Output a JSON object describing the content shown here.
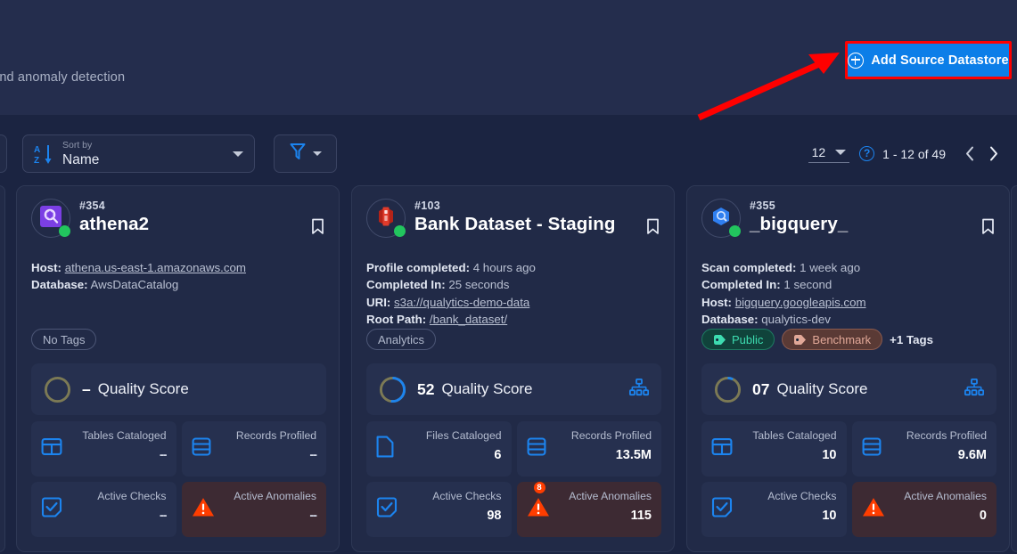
{
  "header": {
    "subtitle": "nitoring, and anomaly detection",
    "add_datastore_label": "Add Source Datastore",
    "add_icon": "plus-circle-icon",
    "highlight_color": "#ff0000",
    "button_color": "#0c7ee8"
  },
  "toolbar": {
    "sort": {
      "icon": "sort-az-icon",
      "label": "Sort by",
      "value": "Name",
      "caret": "chevron-down-icon"
    },
    "filter": {
      "icon": "filter-funnel-icon",
      "caret": "chevron-down-icon"
    }
  },
  "pagination": {
    "per_page": "12",
    "per_page_caret": "chevron-down-icon",
    "help_icon": "help-circle-icon",
    "help_glyph": "?",
    "range": "1 - 12 of 49",
    "prev_icon": "chevron-left-icon",
    "next_icon": "chevron-right-icon"
  },
  "cards": [
    {
      "id": "#354",
      "title": "athena2",
      "avatar_icon": "aws-athena-icon",
      "status": "online",
      "bookmark_icon": "bookmark-icon",
      "meta": [
        {
          "key": "Host:",
          "value": "athena.us-east-1.amazonaws.com",
          "link": true
        },
        {
          "key": "Database:",
          "value": "AwsDataCatalog",
          "link": false
        }
      ],
      "tags": [
        {
          "label": "No Tags",
          "style": "plain",
          "icon": null
        }
      ],
      "more_tags": "",
      "quality": {
        "value": "–",
        "label": "Quality Score",
        "percent": 0,
        "lineage_icon": null
      },
      "tiles": [
        {
          "label": "Tables Cataloged",
          "value": "--",
          "icon": "table-grid-icon",
          "danger": false,
          "badge": null
        },
        {
          "label": "Records Profiled",
          "value": "--",
          "icon": "database-icon",
          "danger": false,
          "badge": null
        },
        {
          "label": "Active Checks",
          "value": "--",
          "icon": "checklist-icon",
          "danger": false,
          "badge": null
        },
        {
          "label": "Active Anomalies",
          "value": "--",
          "icon": "warning-triangle-icon",
          "danger": true,
          "badge": null
        }
      ]
    },
    {
      "id": "#103",
      "title": "Bank Dataset - Staging",
      "avatar_icon": "aws-s3-icon",
      "status": "online",
      "bookmark_icon": "bookmark-icon",
      "meta": [
        {
          "key": "Profile completed:",
          "value": "4 hours ago",
          "link": false
        },
        {
          "key": "Completed In:",
          "value": "25 seconds",
          "link": false
        },
        {
          "key": "URI:",
          "value": "s3a://qualytics-demo-data",
          "link": true
        },
        {
          "key": "Root Path:",
          "value": "/bank_dataset/",
          "link": true
        }
      ],
      "tags": [
        {
          "label": "Analytics",
          "style": "plain",
          "icon": null
        }
      ],
      "more_tags": "",
      "quality": {
        "value": "52",
        "label": "Quality Score",
        "percent": 52,
        "lineage_icon": "lineage-hierarchy-icon"
      },
      "tiles": [
        {
          "label": "Files Cataloged",
          "value": "6",
          "icon": "file-icon",
          "danger": false,
          "badge": null
        },
        {
          "label": "Records Profiled",
          "value": "13.5M",
          "icon": "database-icon",
          "danger": false,
          "badge": null
        },
        {
          "label": "Active Checks",
          "value": "98",
          "icon": "checklist-icon",
          "danger": false,
          "badge": null
        },
        {
          "label": "Active Anomalies",
          "value": "115",
          "icon": "warning-triangle-icon",
          "danger": true,
          "badge": "8"
        }
      ]
    },
    {
      "id": "#355",
      "title": "_bigquery_",
      "avatar_icon": "google-bigquery-icon",
      "status": "online",
      "bookmark_icon": "bookmark-icon",
      "meta": [
        {
          "key": "Scan completed:",
          "value": "1 week ago",
          "link": false
        },
        {
          "key": "Completed In:",
          "value": "1 second",
          "link": false
        },
        {
          "key": "Host:",
          "value": "bigquery.googleapis.com",
          "link": true
        },
        {
          "key": "Database:",
          "value": "qualytics-dev",
          "link": false
        }
      ],
      "tags": [
        {
          "label": "Public",
          "style": "teal",
          "icon": "tag-icon"
        },
        {
          "label": "Benchmark",
          "style": "brown",
          "icon": "tag-icon"
        }
      ],
      "more_tags": "+1 Tags",
      "quality": {
        "value": "07",
        "label": "Quality Score",
        "percent": 7,
        "lineage_icon": "lineage-hierarchy-icon"
      },
      "tiles": [
        {
          "label": "Tables Cataloged",
          "value": "10",
          "icon": "table-grid-icon",
          "danger": false,
          "badge": null
        },
        {
          "label": "Records Profiled",
          "value": "9.6M",
          "icon": "database-icon",
          "danger": false,
          "badge": null
        },
        {
          "label": "Active Checks",
          "value": "10",
          "icon": "checklist-icon",
          "danger": false,
          "badge": null
        },
        {
          "label": "Active Anomalies",
          "value": "0",
          "icon": "warning-triangle-icon",
          "danger": true,
          "badge": null
        }
      ]
    }
  ]
}
